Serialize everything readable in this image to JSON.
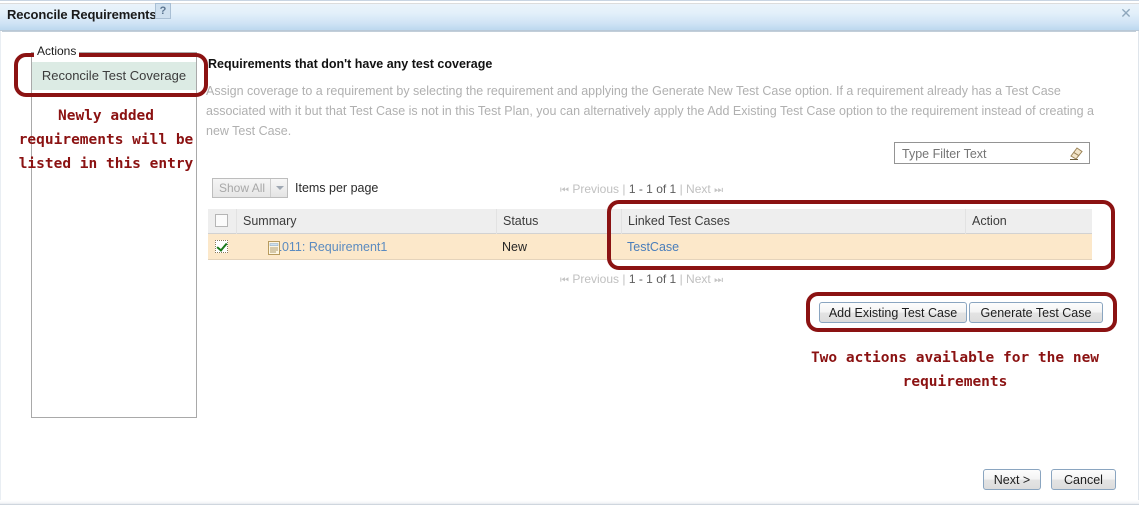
{
  "window": {
    "title": "Reconcile Requirements",
    "help_icon": "question-mark-icon",
    "close_icon": "close-icon",
    "close_glyph": "✕"
  },
  "actions_panel": {
    "legend": "Actions",
    "items": [
      {
        "label": "Reconcile Test Coverage",
        "selected": true
      }
    ]
  },
  "main": {
    "heading": "Requirements that don't have any test coverage",
    "description": "Assign coverage to a requirement by selecting the requirement and applying the Generate New Test Case option. If a requirement already has a Test Case associated with it but that Test Case is not in this Test Plan, you can alternatively apply the Add Existing Test Case option to the requirement instead of creating a new Test Case."
  },
  "filter": {
    "placeholder": "Type Filter Text",
    "value": "",
    "clear_icon": "eraser-icon"
  },
  "toolbar": {
    "show_all_label": "Show All",
    "items_per_page_label": "Items per page",
    "dropdown_icon": "chevron-down-icon"
  },
  "pagination": {
    "first_icon": "⏪",
    "previous_label": "Previous",
    "separator": "|",
    "range_label": "1 - 1 of 1",
    "next_label": "Next",
    "last_icon": "⏩"
  },
  "table": {
    "columns": [
      "Summary",
      "Status",
      "Linked Test Cases",
      "Action"
    ],
    "rows": [
      {
        "checked": true,
        "summary": "1011: Requirement1",
        "status": "New",
        "linked_test_cases": "TestCase",
        "action": ""
      }
    ]
  },
  "action_buttons": {
    "add_existing": "Add Existing Test Case",
    "generate": "Generate Test Case"
  },
  "footer_buttons": {
    "next": "Next >",
    "cancel": "Cancel"
  },
  "annotations": {
    "left_note": "Newly added\nrequirements will be\nlisted in this entry",
    "buttons_note": "Two actions available for the new\nrequirements",
    "color": "#8b1212"
  }
}
